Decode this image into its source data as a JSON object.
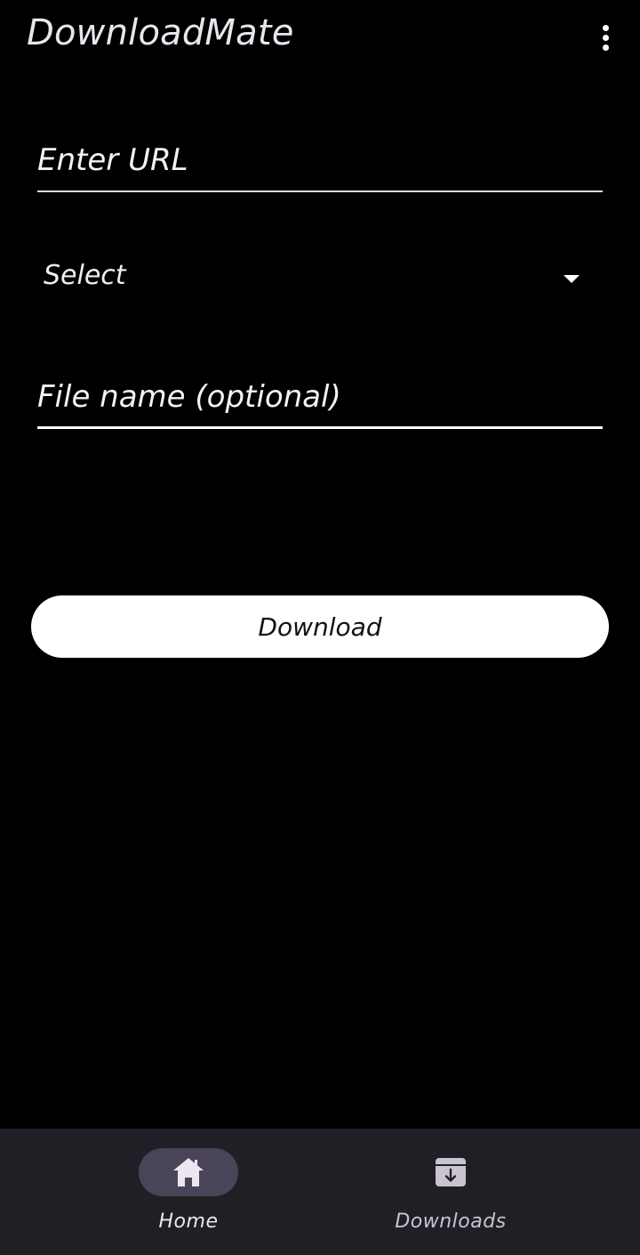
{
  "app": {
    "title": "DownloadMate"
  },
  "form": {
    "url_placeholder": "Enter URL",
    "select_label": "Select",
    "filename_placeholder": "File name (optional)",
    "download_label": "Download"
  },
  "bottom_nav": {
    "items": [
      {
        "label": "Home",
        "icon": "home-icon",
        "active": true
      },
      {
        "label": "Downloads",
        "icon": "download-box-icon",
        "active": false
      }
    ]
  },
  "colors": {
    "background": "#000000",
    "nav_background": "#211f26",
    "active_pill": "#4a4458",
    "button": "#ffffff"
  }
}
